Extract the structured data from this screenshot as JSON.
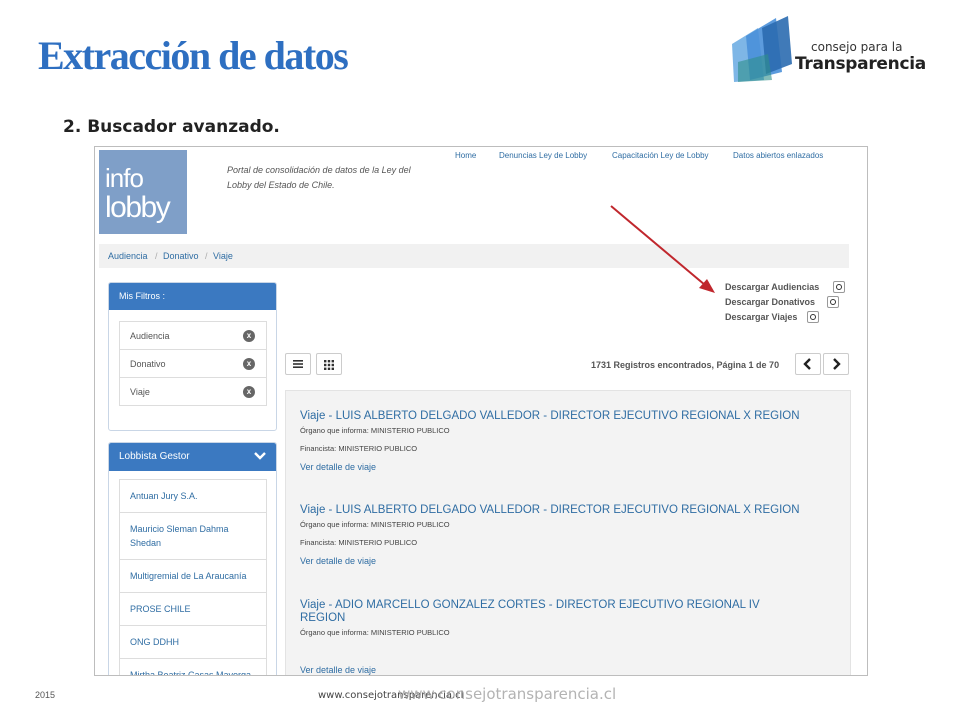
{
  "slide": {
    "title": "Extracción de datos",
    "subtitle": "2. Buscador avanzado.",
    "footer_year": "2015",
    "footer_url": "www.consejotransparencia.cl",
    "footer_watermark": "www.consejotransparencia.cl"
  },
  "logo": {
    "line1": "consejo para la",
    "line2": "Transparencia",
    "colors": [
      "#2b6cb0",
      "#4a90d9",
      "#7eb6e6",
      "#2e8f8a"
    ]
  },
  "portal": {
    "logo_line1": "info",
    "logo_line2": "lobby",
    "description": "Portal de consolidación de datos de la Ley del Lobby del Estado de Chile.",
    "nav": [
      "Home",
      "Denuncias Ley de Lobby",
      "Capacitación Ley de Lobby",
      "Datos abiertos enlazados"
    ],
    "breadcrumb": [
      "Audiencia",
      "Donativo",
      "Viaje"
    ],
    "breadcrumb_sep": "/",
    "downloads": [
      "Descargar Audiencias",
      "Descargar Donativos",
      "Descargar Viajes"
    ],
    "filters": {
      "title": "Mis Filtros :",
      "items": [
        "Audiencia",
        "Donativo",
        "Viaje"
      ],
      "remove_glyph": "x"
    },
    "gestor": {
      "title": "Lobbista Gestor",
      "items": [
        "Antuan Jury S.A.",
        "Mauricio Sleman Dahma Shedan",
        "Multigremial de La Araucanía",
        "PROSE CHILE",
        "ONG DDHH",
        "Mirtha Beatriz Casas Mayorga"
      ]
    },
    "records_text": "1731 Registros encontrados, Página 1 de 70",
    "results": [
      {
        "title": "Viaje - LUIS ALBERTO DELGADO VALLEDOR - DIRECTOR EJECUTIVO REGIONAL X REGION",
        "organo": "Órgano que informa: MINISTERIO PUBLICO",
        "financista": "Financista: MINISTERIO PUBLICO",
        "link": "Ver detalle de viaje"
      },
      {
        "title": "Viaje - LUIS ALBERTO DELGADO VALLEDOR - DIRECTOR EJECUTIVO REGIONAL X REGION",
        "organo": "Órgano que informa: MINISTERIO PUBLICO",
        "financista": "Financista: MINISTERIO PUBLICO",
        "link": "Ver detalle de viaje"
      },
      {
        "title": "Viaje - ADIO MARCELLO GONZALEZ CORTES - DIRECTOR EJECUTIVO REGIONAL IV REGION",
        "organo": "Órgano que informa: MINISTERIO PUBLICO",
        "financista": "",
        "link": "Ver detalle de viaje"
      }
    ],
    "annotation_arrow_color": "#c0272d"
  }
}
